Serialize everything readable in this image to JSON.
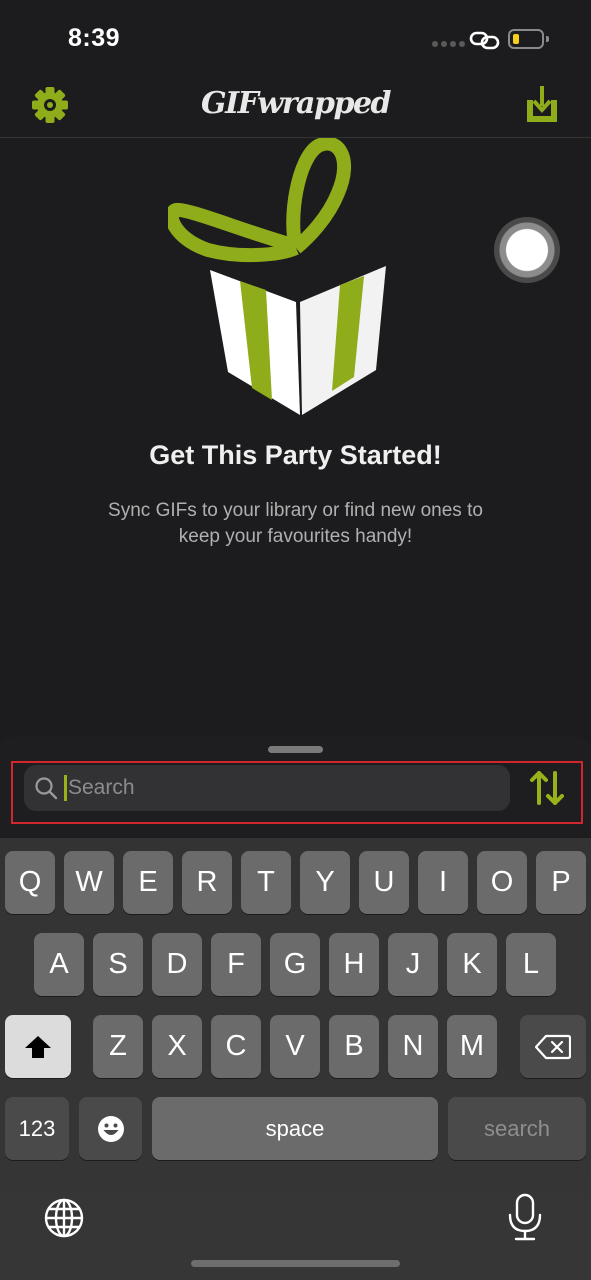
{
  "status_bar": {
    "time": "8:39",
    "icons": [
      "signal-dots",
      "link-icon",
      "battery-icon"
    ],
    "battery_level": 0.15,
    "battery_color": "#f4cf1d"
  },
  "nav": {
    "title": "GIFwrapped",
    "left_icon": "gear-icon",
    "right_icon": "download-tray-icon",
    "accent": "#8fac1a"
  },
  "empty_state": {
    "illustration": "gift-box",
    "title": "Get This Party Started!",
    "subtitle": "Sync GIFs to your library or find new ones to keep your favourites handy!"
  },
  "search": {
    "placeholder": "Search",
    "value": "",
    "sort_icon": "sort-arrows-icon"
  },
  "keyboard": {
    "row1": [
      "Q",
      "W",
      "E",
      "R",
      "T",
      "Y",
      "U",
      "I",
      "O",
      "P"
    ],
    "row2": [
      "A",
      "S",
      "D",
      "F",
      "G",
      "H",
      "J",
      "K",
      "L"
    ],
    "row3": [
      "Z",
      "X",
      "C",
      "V",
      "B",
      "N",
      "M"
    ],
    "numbers_label": "123",
    "space_label": "space",
    "return_label": "search",
    "shift_icon": "shift-icon",
    "delete_icon": "delete-icon",
    "emoji_icon": "emoji-icon",
    "globe_icon": "globe-icon",
    "mic_icon": "microphone-icon"
  }
}
